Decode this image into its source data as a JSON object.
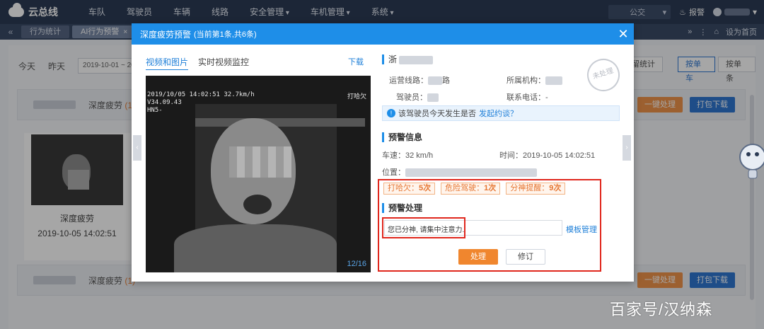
{
  "topnav": {
    "logo": "云总线",
    "items": [
      "车队",
      "驾驶员",
      "车辆",
      "线路",
      "安全管理",
      "车机管理",
      "系统"
    ],
    "org_select": "公交",
    "alert": "报警"
  },
  "tabbar": {
    "tabs": [
      {
        "label": "行为统计"
      },
      {
        "label": "AI行为预警"
      }
    ],
    "home": "设为首页"
  },
  "page": {
    "filters": [
      "今天",
      "昨天"
    ],
    "date_range": "2019-10-01 ~ 20",
    "stats_btn": "留统计",
    "mode_single": "按单车",
    "mode_batch": "按单条",
    "batch_process": "一键处理",
    "batch_download": "打包下载",
    "card1_title": "深度疲劳",
    "card1_count": "(1)",
    "card2_title": "深度疲劳",
    "card2_count": "(1)",
    "thumb_title": "深度疲劳",
    "thumb_time": "2019-10-05 14:02:51"
  },
  "modal": {
    "title": "深度疲劳预警",
    "subtitle": "(当前第1条,共6条)",
    "tab_media": "视频和图片",
    "tab_live": "实时视频监控",
    "download": "下载",
    "osd_line1": "2019/10/05 14:02:51  32.7km/h",
    "osd_line2": "V34.09.43",
    "osd_line3": "HN5-",
    "osd_event": "打哈欠",
    "counter": "12/16",
    "plate_prefix": "浙",
    "stamp": "未处理",
    "route_label": "运营线路：",
    "route_suffix": "路",
    "org_label": "所属机构：",
    "driver_label": "驾驶员：",
    "phone_label": "联系电话：-",
    "tip_text": "该驾驶员今天发生是否",
    "tip_link": "发起约谈？",
    "alert_section": "预警信息",
    "speed": "车速：32 km/h",
    "time": "时间：2019-10-05 14:02:51",
    "location_label": "位置：",
    "tags": [
      {
        "label": "打哈欠：",
        "count": "5次"
      },
      {
        "label": "危险驾驶：",
        "count": "1次"
      },
      {
        "label": "分神提醒：",
        "count": "9次"
      }
    ],
    "process_section": "预警处理",
    "process_text": "您已分神, 请集中注意力.",
    "template_link": "模板管理",
    "btn_process": "处理",
    "btn_revise": "修订"
  },
  "watermark": "百家号/汉纳森"
}
